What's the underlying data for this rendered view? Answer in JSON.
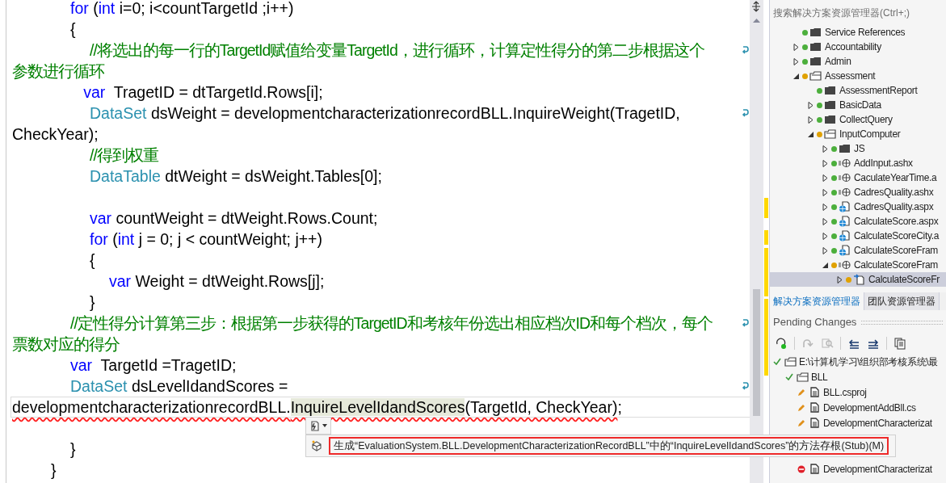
{
  "editor": {
    "lines": [
      {
        "current": false,
        "wrapped": false,
        "tokens": [
          {
            "kind": "keyword",
            "text": "\t\t\tfor"
          },
          {
            "kind": "plain",
            "text": " ("
          },
          {
            "kind": "keyword",
            "text": "int"
          },
          {
            "kind": "plain",
            "text": " i=0; i<countTargetId ;i++)"
          }
        ]
      },
      {
        "current": false,
        "wrapped": false,
        "tokens": [
          {
            "kind": "plain",
            "text": "\t\t\t{"
          }
        ]
      },
      {
        "current": false,
        "wrapped": true,
        "tokens": [
          {
            "kind": "comment",
            "text": "\t\t\t\t//将选出的每一行的TargetId赋值给变量TargetId，进行循环，计算定性得分的第二步根据这个"
          }
        ]
      },
      {
        "current": false,
        "wrapped": false,
        "tokens": [
          {
            "kind": "comment",
            "text": "参数进行循环"
          }
        ]
      },
      {
        "current": false,
        "wrapped": false,
        "tokens": [
          {
            "kind": "keyword",
            "text": "\t\t\t   var"
          },
          {
            "kind": "plain",
            "text": "  TragetID = dtTargetId.Rows[i];"
          }
        ]
      },
      {
        "current": false,
        "wrapped": true,
        "tokens": [
          {
            "kind": "type",
            "text": "\t\t\t\tDataSet"
          },
          {
            "kind": "plain",
            "text": " dsWeight = developmentcharacterizationrecordBLL.InquireWeight(TragetID,"
          }
        ]
      },
      {
        "current": false,
        "wrapped": false,
        "tokens": [
          {
            "kind": "plain",
            "text": "CheckYear);"
          }
        ]
      },
      {
        "current": false,
        "wrapped": false,
        "tokens": [
          {
            "kind": "comment",
            "text": "\t\t\t\t//得到权重"
          }
        ]
      },
      {
        "current": false,
        "wrapped": false,
        "tokens": [
          {
            "kind": "type",
            "text": "\t\t\t\tDataTable"
          },
          {
            "kind": "plain",
            "text": " dtWeight = dsWeight.Tables[0];"
          }
        ]
      },
      {
        "current": false,
        "wrapped": false
      },
      {
        "current": false,
        "wrapped": false,
        "tokens": [
          {
            "kind": "keyword",
            "text": "\t\t\t\tvar"
          },
          {
            "kind": "plain",
            "text": " countWeight = dtWeight.Rows.Count;"
          }
        ]
      },
      {
        "current": false,
        "wrapped": false,
        "tokens": [
          {
            "kind": "keyword",
            "text": "\t\t\t\tfor"
          },
          {
            "kind": "plain",
            "text": " ("
          },
          {
            "kind": "keyword",
            "text": "int"
          },
          {
            "kind": "plain",
            "text": " j = 0; j < countWeight; j++)"
          }
        ]
      },
      {
        "current": false,
        "wrapped": false,
        "tokens": [
          {
            "kind": "plain",
            "text": "\t\t\t\t{"
          }
        ]
      },
      {
        "current": false,
        "wrapped": false,
        "tokens": [
          {
            "kind": "keyword",
            "text": "\t\t\t\t\tvar"
          },
          {
            "kind": "plain",
            "text": " Weight = dtWeight.Rows[j];"
          }
        ]
      },
      {
        "current": false,
        "wrapped": false,
        "tokens": [
          {
            "kind": "plain",
            "text": "\t\t\t\t}"
          }
        ]
      },
      {
        "current": false,
        "wrapped": true,
        "tokens": [
          {
            "kind": "comment",
            "text": "\t\t\t//定性得分计算第三步：根据第一步获得的TargetID和考核年份选出相应档次ID和每个档次，每个"
          }
        ]
      },
      {
        "current": false,
        "wrapped": false,
        "tokens": [
          {
            "kind": "comment",
            "text": "票数对应的得分"
          }
        ]
      },
      {
        "current": false,
        "wrapped": false,
        "tokens": [
          {
            "kind": "keyword",
            "text": "\t\t\tvar"
          },
          {
            "kind": "plain",
            "text": "  TargetId =TragetID;"
          }
        ]
      },
      {
        "current": false,
        "wrapped": true,
        "tokens": [
          {
            "kind": "type",
            "text": "\t\t\tDataSet"
          },
          {
            "kind": "plain",
            "text": " dsLevelIdandScores ="
          }
        ]
      },
      {
        "current": true,
        "wrapped": false,
        "tokens": [
          {
            "kind": "error",
            "text": "developmentcharacterizationrecordBLL."
          },
          {
            "kind": "error-highlight",
            "text": "InquireLevelIdandScores"
          },
          {
            "kind": "error",
            "text": "(TargetId, CheckYear)"
          },
          {
            "kind": "plain",
            "text": ";"
          }
        ]
      },
      {
        "current": false,
        "wrapped": false
      },
      {
        "current": false,
        "tokens": [
          {
            "kind": "plain",
            "text": "\t\t\t}"
          }
        ]
      },
      {
        "current": false,
        "wrapped": false,
        "tokens": [
          {
            "kind": "plain",
            "text": "\t\t}"
          }
        ]
      }
    ]
  },
  "smart_tag": {
    "action": "生成“EvaluationSystem.BLL.DevelopmentCharacterizationRecordBLL”中的“InquireLevelIdandScores”的方法存根(Stub)(M)"
  },
  "solution_explorer": {
    "search": {
      "placeholder": "搜索解决方案资源管理器(Ctrl+;)"
    },
    "tree": [
      {
        "label": "Service References",
        "kind": "folder",
        "color": "#4caf3c",
        "selected": false
      },
      {
        "label": "Accountability",
        "kind": "folder",
        "color": "#4caf3c",
        "expanded": false,
        "selected": false
      },
      {
        "label": "Admin",
        "kind": "folder",
        "color": "#4caf3c",
        "expanded": false,
        "selected": false
      },
      {
        "label": "Assessment",
        "kind": "folder",
        "color": "#e0a100",
        "expanded": true,
        "selected": false,
        "children": [
          {
            "label": "AssessmentReport",
            "kind": "folder",
            "color": "#4caf3c",
            "selected": false
          },
          {
            "label": "BasicData",
            "kind": "folder",
            "color": "#4caf3c",
            "expanded": false,
            "selected": false
          },
          {
            "label": "CollectQuery",
            "kind": "folder",
            "color": "#4caf3c",
            "expanded": false,
            "selected": false
          },
          {
            "label": "InputComputer",
            "kind": "folder",
            "color": "#e0a100",
            "expanded": true,
            "selected": false,
            "children": [
              {
                "label": "JS",
                "kind": "folder",
                "color": "#4caf3c",
                "expanded": false,
                "selected": false
              },
              {
                "label": "AddInput.ashx",
                "kind": "handler",
                "color": "#4caf3c",
                "expanded": false,
                "selected": false
              },
              {
                "label": "CaculateYearTime.a",
                "kind": "handler",
                "color": "#4caf3c",
                "expanded": false,
                "selected": false
              },
              {
                "label": "CadresQuality.ashx",
                "kind": "handler",
                "color": "#4caf3c",
                "expanded": false,
                "selected": false
              },
              {
                "label": "CadresQuality.aspx",
                "kind": "page",
                "color": "#4caf3c",
                "expanded": false,
                "selected": false
              },
              {
                "label": "CalculateScore.aspx",
                "kind": "page",
                "color": "#4caf3c",
                "expanded": false,
                "selected": false
              },
              {
                "label": "CalculateScoreCity.a",
                "kind": "page",
                "color": "#4caf3c",
                "expanded": false,
                "selected": false
              },
              {
                "label": "CalculateScoreFram",
                "kind": "page",
                "color": "#4caf3c",
                "expanded": false,
                "selected": false
              },
              {
                "label": "CalculateScoreFram",
                "kind": "handler",
                "color": "#e0a100",
                "expanded": true,
                "selected": false,
                "children": [
                  {
                    "label": "CalculateScoreFr",
                    "kind": "code",
                    "color": "#e0a100",
                    "expanded": false,
                    "selected": true
                  }
                ]
              }
            ]
          }
        ]
      }
    ],
    "tabs": [
      {
        "label": "解决方案资源管理器",
        "selected": true
      },
      {
        "label": "团队资源管理器",
        "selected": false
      }
    ]
  },
  "pending_changes": {
    "title": "Pending Changes",
    "toolbar": [
      {
        "kind": "refresh",
        "disabled": false
      },
      {
        "kind": "redo",
        "disabled": true
      },
      {
        "kind": "compare",
        "disabled": true
      },
      {
        "kind": "undo-list",
        "disabled": false
      },
      {
        "kind": "redo-list",
        "disabled": false
      },
      {
        "kind": "document",
        "disabled": false
      }
    ],
    "tree": [
      {
        "label": "E:\\计算机学习\\组织部考核系统\\最",
        "kind": "folder",
        "children": [
          {
            "label": "BLL",
            "kind": "folder",
            "children": [
              {
                "label": "BLL.csproj",
                "kind": "edit"
              },
              {
                "label": "DevelopmentAddBll.cs",
                "kind": "edit"
              },
              {
                "label": "DevelopmentCharacterizat",
                "kind": "edit"
              },
              {
                "kind": "hidden"
              },
              {
                "kind": "hidden"
              },
              {
                "label": "DevelopmentCharacterizat",
                "kind": "delete"
              }
            ]
          }
        ]
      }
    ]
  }
}
